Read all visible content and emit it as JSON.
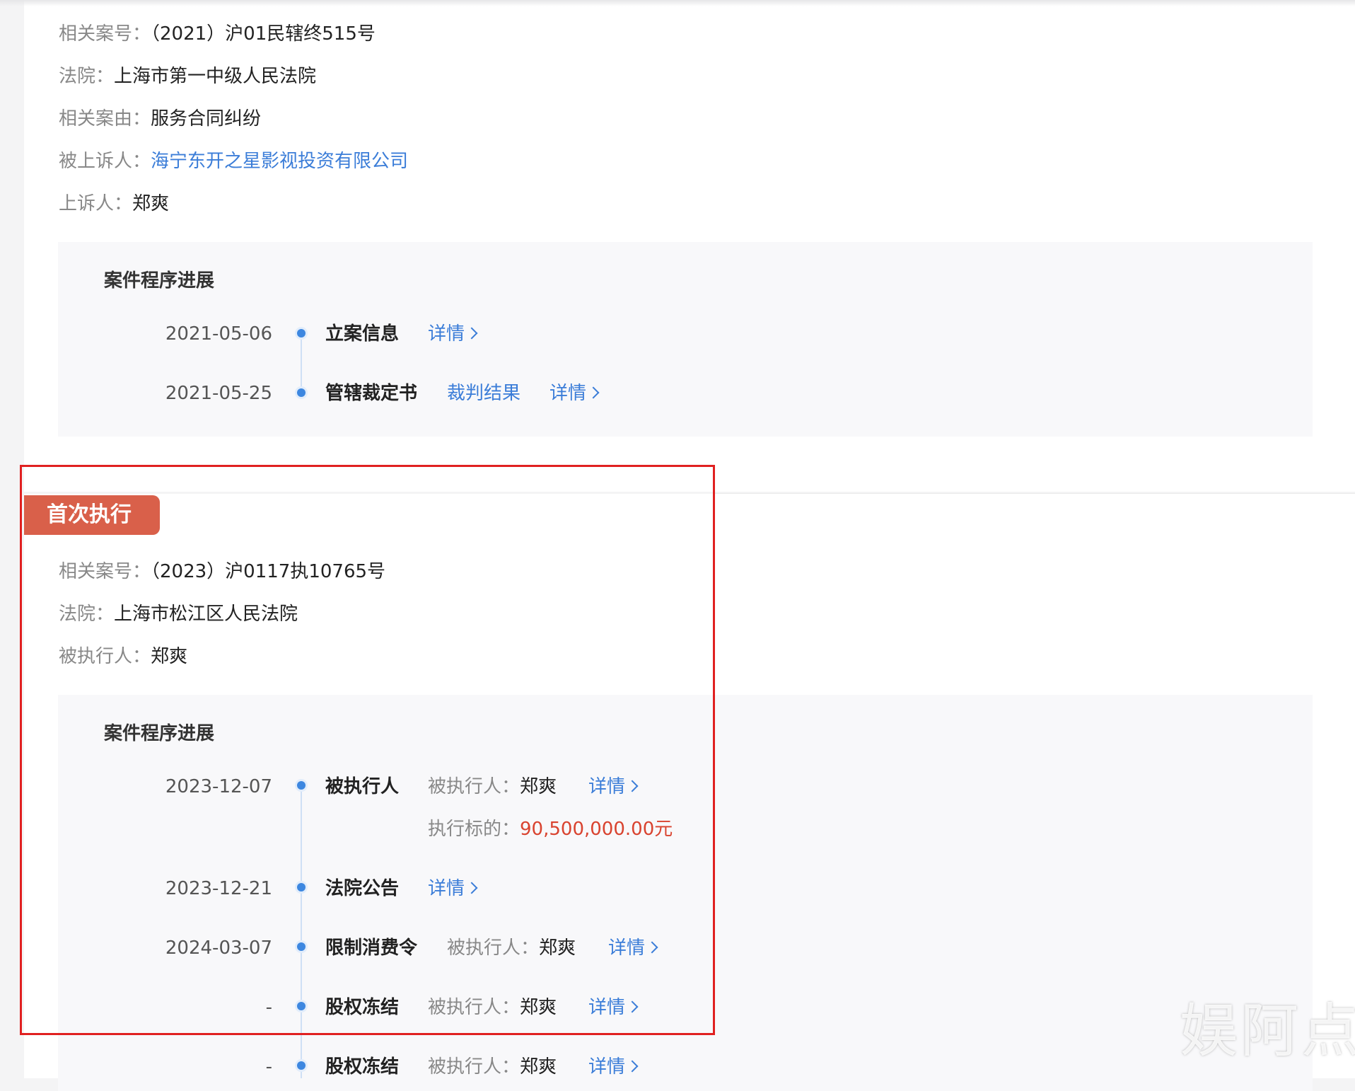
{
  "case1": {
    "fields": [
      {
        "label": "相关案号：",
        "value": "（2021）沪01民辖终515号"
      },
      {
        "label": "法院：",
        "value": "上海市第一中级人民法院"
      },
      {
        "label": "相关案由：",
        "value": "服务合同纠纷"
      },
      {
        "label": "被上诉人：",
        "value": "海宁东开之星影视投资有限公司"
      },
      {
        "label": "上诉人：",
        "value": "郑爽"
      }
    ],
    "progress": {
      "title": "案件程序进展",
      "items": [
        {
          "date": "2021-05-06",
          "title": "立案信息",
          "detail": "详情"
        },
        {
          "date": "2021-05-25",
          "title": "管辖裁定书",
          "extra_link": "裁判结果",
          "detail": "详情"
        }
      ]
    }
  },
  "case2": {
    "tag": "首次执行",
    "fields": [
      {
        "label": "相关案号：",
        "value": "（2023）沪0117执10765号"
      },
      {
        "label": "法院：",
        "value": "上海市松江区人民法院"
      },
      {
        "label": "被执行人：",
        "value": "郑爽"
      }
    ],
    "progress": {
      "title": "案件程序进展",
      "items": [
        {
          "date": "2023-12-07",
          "title": "被执行人",
          "label": "被执行人：",
          "value": "郑爽",
          "detail": "详情",
          "sub_label": "执行标的：",
          "sub_value": "90,500,000.00元"
        },
        {
          "date": "2023-12-21",
          "title": "法院公告",
          "detail": "详情"
        },
        {
          "date": "2024-03-07",
          "title": "限制消费令",
          "label": "被执行人：",
          "value": "郑爽",
          "detail": "详情"
        },
        {
          "date": "-",
          "title": "股权冻结",
          "label": "被执行人：",
          "value": "郑爽",
          "detail": "详情"
        },
        {
          "date": "-",
          "title": "股权冻结",
          "label": "被执行人：",
          "value": "郑爽",
          "detail": "详情"
        }
      ]
    }
  },
  "watermark": "娱阿点",
  "colors": {
    "link": "#3b7dd8",
    "amount": "#d9432f",
    "tag": "#d9604a",
    "highlight": "#e02020",
    "dot": "#3d87e0"
  }
}
